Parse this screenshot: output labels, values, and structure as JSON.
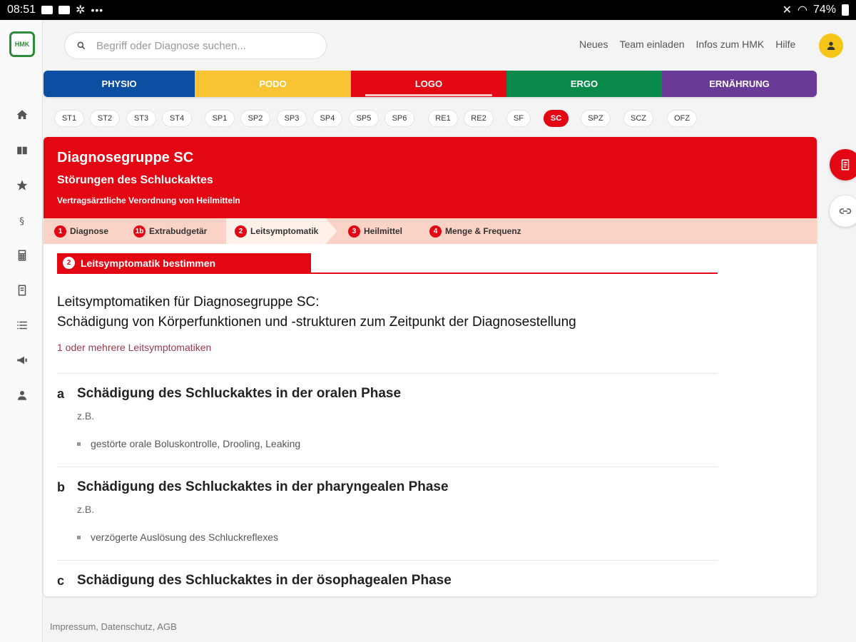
{
  "statusbar": {
    "time": "08:51",
    "battery": "74%"
  },
  "logo": {
    "text": "HMK"
  },
  "search": {
    "placeholder": "Begriff oder Diagnose suchen..."
  },
  "header_links": [
    "Neues",
    "Team einladen",
    "Infos zum HMK",
    "Hilfe"
  ],
  "categories": [
    {
      "label": "PHYSIO",
      "color": "#0b4ea2"
    },
    {
      "label": "PODO",
      "color": "#f9c433"
    },
    {
      "label": "LOGO",
      "color": "#e30613",
      "active": true
    },
    {
      "label": "ERGO",
      "color": "#0a8a4a"
    },
    {
      "label": "ERNÄHRUNG",
      "color": "#6a3a97"
    }
  ],
  "chips": [
    "ST1",
    "ST2",
    "ST3",
    "ST4",
    "SP1",
    "SP2",
    "SP3",
    "SP4",
    "SP5",
    "SP6",
    "RE1",
    "RE2",
    "SF",
    "SC",
    "SPZ",
    "SCZ",
    "OFZ"
  ],
  "active_chip": "SC",
  "card": {
    "title": "Diagnosegruppe SC",
    "subtitle": "Störungen des Schluckaktes",
    "caption": "Vertragsärztliche Verordnung von Heilmitteln",
    "steps": [
      {
        "num": "1",
        "label": "Diagnose"
      },
      {
        "num": "1b",
        "label": "Extrabudgetär"
      },
      {
        "num": "2",
        "label": "Leitsymptomatik",
        "active": true
      },
      {
        "num": "3",
        "label": "Heilmittel"
      },
      {
        "num": "4",
        "label": "Menge & Frequenz"
      }
    ],
    "section": {
      "num": "2",
      "label": "Leitsymptomatik bestimmen"
    },
    "heading_line1": "Leitsymptomatiken für Diagnosegruppe SC:",
    "heading_line2": "Schädigung von Körperfunktionen und -strukturen zum Zeitpunkt der Diagnosestellung",
    "hint": "1 oder mehrere Leitsymptomatiken",
    "items": [
      {
        "letter": "a",
        "title": "Schädigung des Schluckaktes in der oralen Phase",
        "zb": "z.B.",
        "bullet": "gestörte orale Boluskontrolle, Drooling, Leaking"
      },
      {
        "letter": "b",
        "title": "Schädigung des Schluckaktes in der pharyngealen Phase",
        "zb": "z.B.",
        "bullet": "verzögerte Auslösung des Schluckreflexes"
      },
      {
        "letter": "c",
        "title": "Schädigung des Schluckaktes in der ösophagealen Phase"
      }
    ]
  },
  "footer": "Impressum, Datenschutz, AGB"
}
